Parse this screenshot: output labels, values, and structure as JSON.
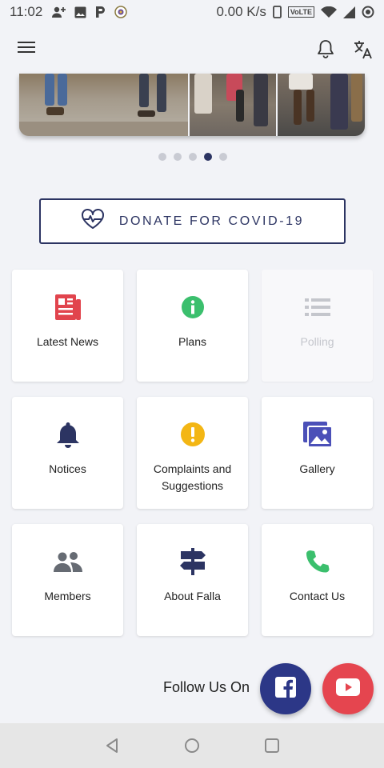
{
  "status_bar": {
    "time": "11:02",
    "network_speed": "0.00 K/s",
    "volte": "VoLTE",
    "notification_icons": [
      "person-add-icon",
      "image-icon",
      "p-icon",
      "badge-icon"
    ],
    "system_icons": [
      "phone-icon",
      "volte-icon",
      "wifi-icon",
      "signal-icon",
      "record-icon"
    ]
  },
  "app_bar": {
    "menu_icon": "hamburger-menu-icon",
    "notification_icon": "bell-icon",
    "language_icon": "translate-icon"
  },
  "carousel": {
    "total": 5,
    "active_index": 3
  },
  "donate": {
    "label": "DONATE FOR COVID-19",
    "icon": "heart-pulse-icon"
  },
  "tiles": [
    {
      "label": "Latest News",
      "icon": "newspaper-icon",
      "color": "#e1444d",
      "enabled": true
    },
    {
      "label": "Plans",
      "icon": "info-icon",
      "color": "#3bbf6d",
      "enabled": true
    },
    {
      "label": "Polling",
      "icon": "list-icon",
      "color": "#c4c6cc",
      "enabled": false
    },
    {
      "label": "Notices",
      "icon": "bell-icon",
      "color": "#2c3462",
      "enabled": true
    },
    {
      "label": "Complaints and\nSuggestions",
      "icon": "alert-icon",
      "color": "#f3b614",
      "enabled": true
    },
    {
      "label": "Gallery",
      "icon": "image-gallery-icon",
      "color": "#4b50b8",
      "enabled": true
    },
    {
      "label": "Members",
      "icon": "people-icon",
      "color": "#666b73",
      "enabled": true
    },
    {
      "label": "About Falla",
      "icon": "signpost-icon",
      "color": "#2c3462",
      "enabled": true
    },
    {
      "label": "Contact Us",
      "icon": "phone-icon",
      "color": "#3bbf6d",
      "enabled": true
    }
  ],
  "follow": {
    "label": "Follow Us On",
    "facebook_icon": "facebook-icon",
    "youtube_icon": "youtube-icon"
  },
  "nav_bar": {
    "buttons": [
      "back-icon",
      "home-icon",
      "recents-icon"
    ]
  }
}
